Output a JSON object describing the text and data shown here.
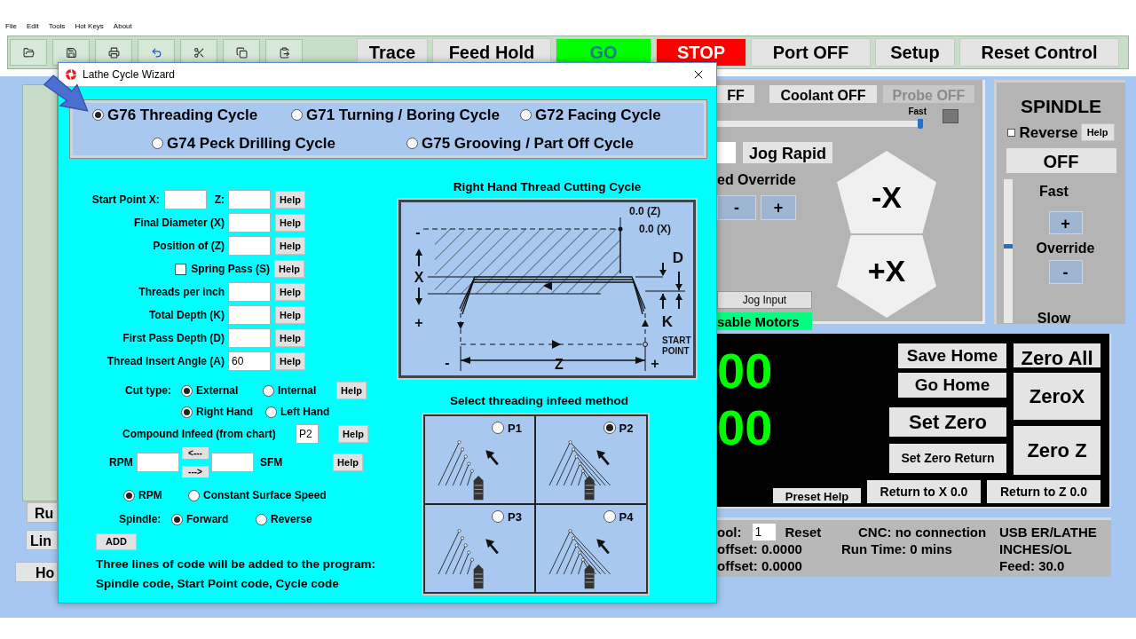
{
  "menu": [
    "File",
    "Edit",
    "Tools",
    "Hot Keys",
    "About"
  ],
  "toolbar": [
    {
      "label": "Trace",
      "kind": "plain"
    },
    {
      "label": "Feed Hold",
      "kind": "plain"
    },
    {
      "label": "GO",
      "kind": "go"
    },
    {
      "label": "STOP",
      "kind": "stop"
    },
    {
      "label": "Port OFF",
      "kind": "plain"
    },
    {
      "label": "Setup",
      "kind": "plain"
    },
    {
      "label": "Reset Control",
      "kind": "plain"
    }
  ],
  "left_buttons": [
    "Ru",
    "Lin",
    "Ho"
  ],
  "controls": {
    "top_buttons": [
      {
        "label": "FF",
        "disabled": false
      },
      {
        "label": "Coolant OFF",
        "disabled": false
      },
      {
        "label": "Probe OFF",
        "disabled": true
      }
    ],
    "speed_label": "Fast",
    "speed_slider": {
      "level": 1
    },
    "jog_rapid": "Jog Rapid",
    "override_label": "ed Override",
    "override_buttons": [
      "-",
      "+"
    ],
    "jog_x": [
      "-X",
      "+X"
    ],
    "jog_input": "Jog Input",
    "motors": "sable Motors"
  },
  "spindle": {
    "title": "SPINDLE",
    "reverse": {
      "label": "Reverse",
      "checked": false
    },
    "help": "Help",
    "state": "OFF",
    "fast": "Fast",
    "plus": "+",
    "override": "Override",
    "minus": "-",
    "slow": "Slow",
    "slider": {
      "level": 0.52
    }
  },
  "dro": {
    "readouts": [
      "00",
      "00"
    ],
    "home_buttons": [
      "Save Home",
      "Go Home"
    ],
    "zero_buttons": [
      "Set Zero",
      "Set Zero Return"
    ],
    "axis_buttons": [
      "Zero All",
      "ZeroX",
      "Zero Z"
    ],
    "bottom_buttons": [
      "Preset Help",
      "Return to X 0.0",
      "Return to Z 0.0"
    ]
  },
  "status": {
    "tool_label": "ool:",
    "tool_value": "1",
    "reset": "Reset",
    "z_offset": "offset: 0.0000",
    "x_offset": "offset: 0.0000",
    "cnc": "CNC: no connection",
    "run_time": "Run Time: 0 mins",
    "machine": "USB ER/LATHE",
    "units": "INCHES/OL",
    "feed": "Feed: 30.0"
  },
  "dialog": {
    "title": "Lathe Cycle Wizard",
    "cycles": [
      {
        "label": "G76 Threading Cycle",
        "selected": true
      },
      {
        "label": "G71 Turning / Boring Cycle",
        "selected": false
      },
      {
        "label": "G72 Facing Cycle",
        "selected": false
      },
      {
        "label": "G74 Peck Drilling Cycle",
        "selected": false
      },
      {
        "label": "G75 Grooving / Part Off Cycle",
        "selected": false
      }
    ],
    "start_point": {
      "label": "Start Point X:",
      "z_label": "Z:",
      "help": "Help"
    },
    "rows": [
      {
        "kind": "field",
        "label": "Final Diameter (X)",
        "help": "Help"
      },
      {
        "kind": "field",
        "label": "Position of (Z)",
        "help": "Help"
      },
      {
        "kind": "checkbox",
        "label": "Spring Pass (S)",
        "checked": false,
        "help": "Help"
      },
      {
        "kind": "field",
        "label": "Threads per inch",
        "help": "Help"
      },
      {
        "kind": "field",
        "label": "Total Depth (K)",
        "help": "Help"
      },
      {
        "kind": "field",
        "label": "First Pass Depth (D)",
        "help": "Help"
      },
      {
        "kind": "field",
        "label": "Thread Insert Angle (A)",
        "value": "60",
        "help": "Help"
      }
    ],
    "cut_type": {
      "label": "Cut type:",
      "rows": [
        [
          {
            "label": "External",
            "selected": true
          },
          {
            "label": "Internal",
            "selected": false
          }
        ],
        [
          {
            "label": "Right Hand",
            "selected": true
          },
          {
            "label": "Left Hand",
            "selected": false
          }
        ]
      ],
      "help": "Help"
    },
    "compound": {
      "label": "Compound Infeed (from chart)",
      "value": "P2",
      "help": "Help"
    },
    "speed": {
      "rpm_label": "RPM",
      "to_rpm": "<---",
      "to_sfm": "--->",
      "sfm_label": "SFM",
      "help": "Help"
    },
    "speed_mode": [
      {
        "label": "RPM",
        "selected": true
      },
      {
        "label": "Constant Surface Speed",
        "selected": false
      }
    ],
    "spindle": {
      "label": "Spindle:",
      "options": [
        {
          "label": "Forward",
          "selected": true
        },
        {
          "label": "Reverse",
          "selected": false
        }
      ]
    },
    "add_button": "ADD",
    "note": [
      "Three lines of code will be added to the program:",
      "Spindle code, Start Point code, Cycle code"
    ],
    "diagram": {
      "title": "Right Hand Thread Cutting Cycle",
      "labels": [
        "0.0 (Z)",
        "0.0 (X)",
        "-",
        "X",
        "+",
        "D",
        "K",
        "START",
        "POINT",
        "-",
        "Z",
        "+"
      ]
    },
    "infeed": {
      "title": "Select threading infeed method",
      "options": [
        {
          "label": "P1",
          "selected": false
        },
        {
          "label": "P2",
          "selected": true
        },
        {
          "label": "P3",
          "selected": false
        },
        {
          "label": "P4",
          "selected": false
        }
      ]
    }
  }
}
